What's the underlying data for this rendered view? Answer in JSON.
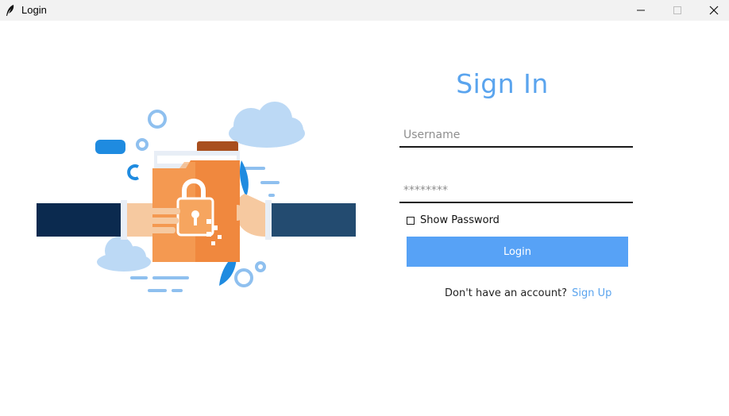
{
  "window": {
    "title": "Login",
    "minimize_icon": "minimize-icon",
    "maximize_icon": "maximize-icon",
    "close_icon": "close-icon"
  },
  "illustration": {
    "icon": "secure-folder-handoff-illustration",
    "colors": {
      "navy": "#0b2a4f",
      "orange": "#f0883e",
      "sky": "#5aa4ee",
      "cloud": "#bcd9f5"
    }
  },
  "form": {
    "title": "Sign In",
    "username_placeholder": "Username",
    "password_placeholder": "********",
    "show_password_label": "Show Password",
    "login_label": "Login",
    "signup_prompt": "Don't have an account?",
    "signup_link": "Sign Up",
    "accent_color": "#5aa4ee",
    "button_color": "#57a2f6"
  }
}
